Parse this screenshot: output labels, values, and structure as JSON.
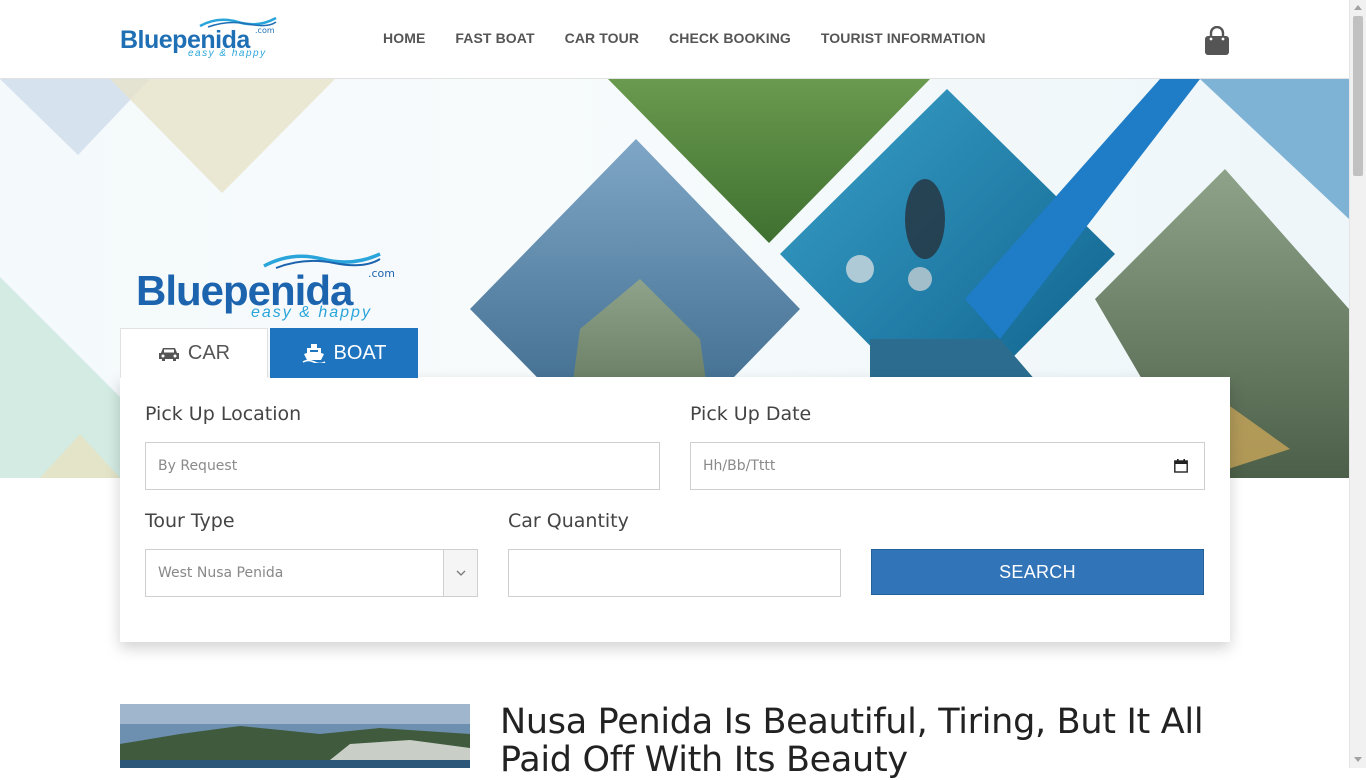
{
  "brand": {
    "name": "Bluepenida",
    "domain": ".com",
    "tagline": "easy & happy",
    "color": "#1f6fb5"
  },
  "nav": {
    "items": [
      "HOME",
      "FAST BOAT",
      "CAR TOUR",
      "CHECK BOOKING",
      "TOURIST INFORMATION"
    ],
    "cart_icon": "shopping-bag-icon"
  },
  "hero": {
    "logo_name": "Bluepenida",
    "logo_domain": ".com",
    "logo_tagline": "easy & happy"
  },
  "tabs": [
    {
      "label": "CAR",
      "icon": "car-icon",
      "active": true
    },
    {
      "label": "BOAT",
      "icon": "ship-icon",
      "active": false
    }
  ],
  "form": {
    "pickup_location": {
      "label": "Pick Up Location",
      "placeholder": "By Request"
    },
    "pickup_date": {
      "label": "Pick Up Date",
      "placeholder": "Hh/Bb/Tttt"
    },
    "tour_type": {
      "label": "Tour Type",
      "value": "West Nusa Penida"
    },
    "car_quantity": {
      "label": "Car Quantity",
      "value": ""
    },
    "search_label": "SEARCH"
  },
  "article": {
    "title": "Nusa Penida Is Beautiful, Tiring, But It All Paid Off With Its Beauty"
  },
  "colors": {
    "accent": "#1f74bf",
    "button": "#3174b8"
  }
}
